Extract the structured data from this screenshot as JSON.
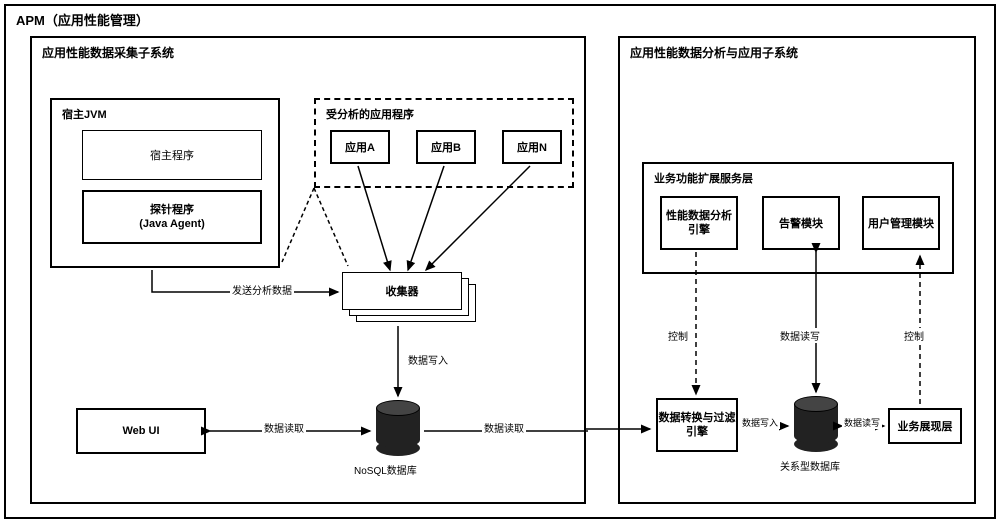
{
  "title": "APM（应用性能管理）",
  "left_system": {
    "title": "应用性能数据采集子系统",
    "jvm": {
      "title": "宿主JVM",
      "host_program": "宿主程序",
      "agent_line1": "探针程序",
      "agent_line2": "(Java Agent)"
    },
    "apps": {
      "title": "受分析的应用程序",
      "app_a": "应用A",
      "app_b": "应用B",
      "app_n": "应用N"
    },
    "collector": "收集器",
    "webui": "Web UI",
    "nosql": "NoSQL数据库"
  },
  "right_system": {
    "title": "应用性能数据分析与应用子系统",
    "service_layer": {
      "title": "业务功能扩展服务层",
      "perf_engine": "性能数据分析引擎",
      "alarm": "告警模块",
      "user_mgmt": "用户管理模块"
    },
    "conv_engine": "数据转换与过滤引擎",
    "rel_db": "关系型数据库",
    "biz_layer": "业务展现层"
  },
  "labels": {
    "send_data": "发送分析数据",
    "data_write": "数据写入",
    "data_read": "数据读取",
    "data_rw": "数据读写",
    "control": "控制"
  }
}
